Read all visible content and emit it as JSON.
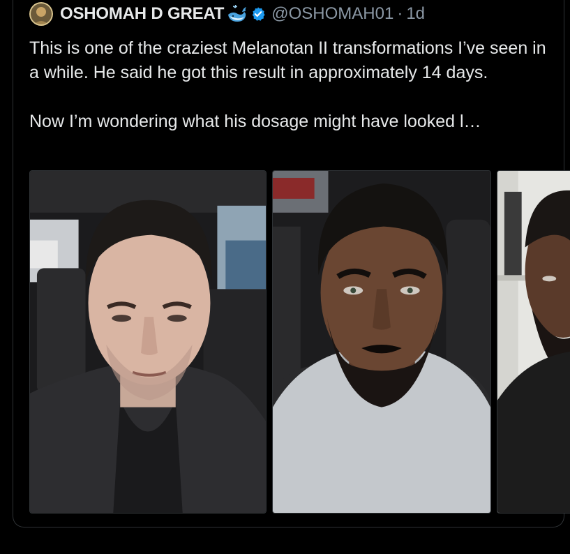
{
  "tweet": {
    "display_name": "OSHOMAH D GREAT",
    "handle": "@OSHOMAH01",
    "separator": "·",
    "timestamp": "1d",
    "paragraph_1": "This is one of the craziest Melanotan II transformations I’ve seen in a while. He said he got this result in approximately 14 days.",
    "paragraph_2": "Now I’m wondering what his dosage might have looked l…"
  },
  "icons": {
    "avatar": "profile-avatar",
    "emoji": "whale-emoji-icon",
    "badge": "verified-badge-icon"
  },
  "colors": {
    "background": "#000000",
    "text": "#e7e9ea",
    "secondary_text": "#8b98a5",
    "verified_blue": "#1d9bf0",
    "border": "#2f3336"
  }
}
